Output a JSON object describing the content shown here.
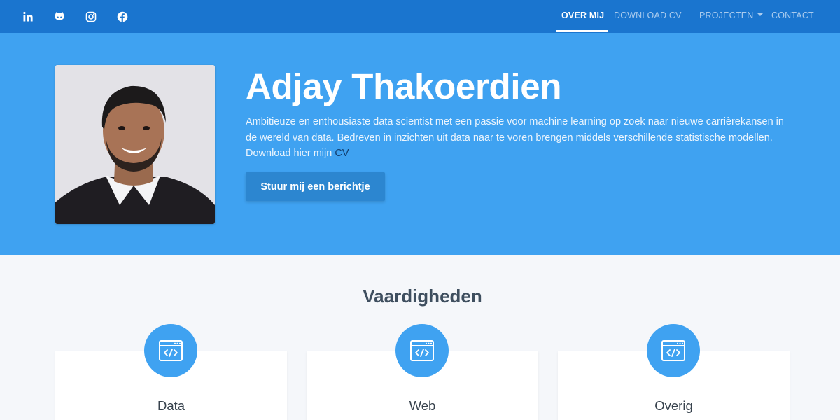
{
  "navbar": {
    "social": [
      {
        "icon": "linkedin-icon"
      },
      {
        "icon": "github-icon"
      },
      {
        "icon": "instagram-icon"
      },
      {
        "icon": "facebook-icon"
      }
    ],
    "links": [
      {
        "label": "OVER MIJ",
        "active": true
      },
      {
        "label": "DOWNLOAD CV",
        "active": false
      },
      {
        "label": "PROJECTEN",
        "active": false,
        "dropdown": true
      },
      {
        "label": "CONTACT",
        "active": false
      }
    ]
  },
  "hero": {
    "name": "Adjay Thakoerdien",
    "intro": "Ambitieuze en enthousiaste data scientist met een passie voor machine learning op zoek naar nieuwe carrièrekansen in de wereld van data. Bedreven in inzichten uit data naar te voren brengen middels verschillende statistische modellen. Download hier mijn ",
    "cv_link": "CV",
    "button": "Stuur mij een berichtje"
  },
  "skills": {
    "title": "Vaardigheden",
    "items": [
      {
        "label": "Data",
        "icon": "code-window-icon"
      },
      {
        "label": "Web",
        "icon": "code-window-icon"
      },
      {
        "label": "Overig",
        "icon": "code-window-icon"
      }
    ]
  },
  "colors": {
    "navbar": "#1a75cf",
    "hero": "#3fa2f1",
    "button": "#2c86d0",
    "background": "#f5f7fa",
    "cv_link": "#123e6e"
  }
}
